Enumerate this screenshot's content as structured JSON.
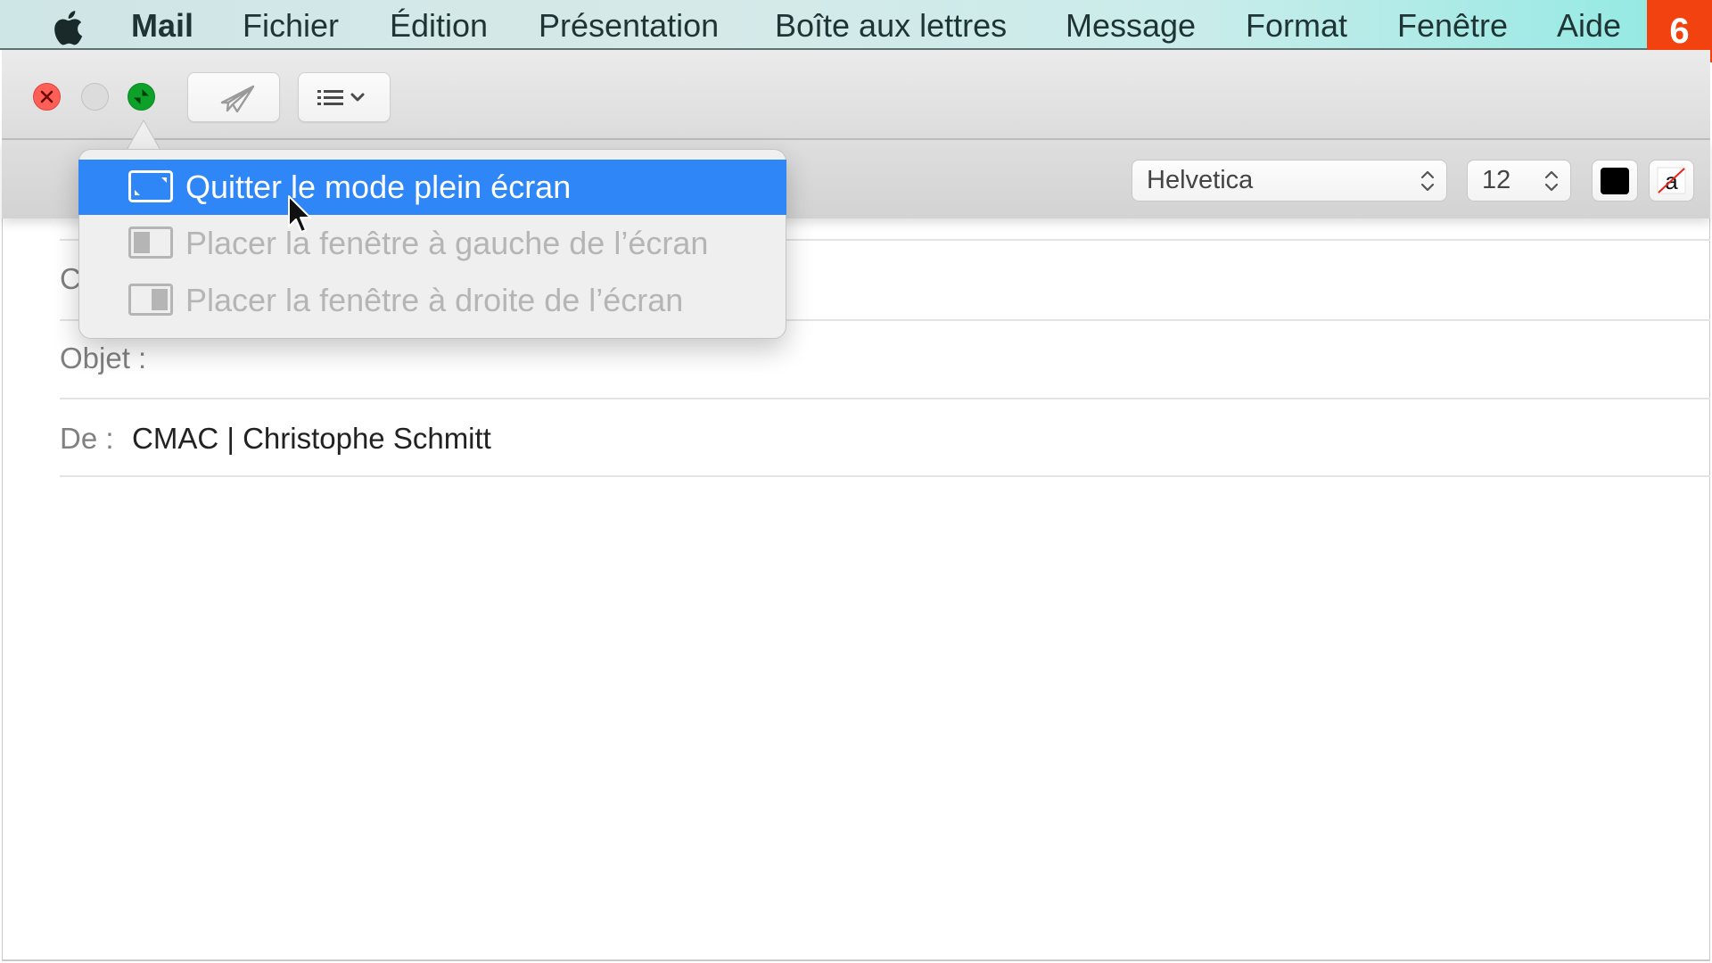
{
  "menubar": {
    "apple_icon": "apple-logo",
    "items": [
      {
        "label": "Mail",
        "bold": true
      },
      {
        "label": "Fichier"
      },
      {
        "label": "Édition"
      },
      {
        "label": "Présentation"
      },
      {
        "label": "Boîte aux lettres"
      },
      {
        "label": "Message"
      },
      {
        "label": "Format"
      },
      {
        "label": "Fenêtre"
      },
      {
        "label": "Aide"
      }
    ],
    "step_badge": "6"
  },
  "toolbar": {
    "close_icon": "close-x",
    "minimize_icon": "minimize",
    "zoom_icon": "exit-fullscreen-arrows",
    "send_icon": "paper-plane",
    "header_fields_icon": "list-with-chevron"
  },
  "format_bar": {
    "font": "Helvetica",
    "size": "12",
    "text_color": "#000000",
    "background_color_icon": "a-strikethrough"
  },
  "popup": {
    "items": [
      {
        "label": "Quitter le mode plein écran",
        "state": "highlighted",
        "icon": "exit-fullscreen"
      },
      {
        "label": "Placer la fenêtre à gauche de l’écran",
        "state": "disabled",
        "icon": "tile-left"
      },
      {
        "label": "Placer la fenêtre à droite de l’écran",
        "state": "disabled",
        "icon": "tile-right"
      }
    ]
  },
  "compose": {
    "fields": [
      {
        "label": "C",
        "value": ""
      },
      {
        "label": "Objet :",
        "value": ""
      },
      {
        "label": "De :",
        "value": "CMAC | Christophe Schmitt"
      }
    ]
  },
  "colors": {
    "highlight": "#2f86f6",
    "badge": "#f2420f",
    "close": "#fe5f57",
    "zoom": "#0da12a"
  }
}
